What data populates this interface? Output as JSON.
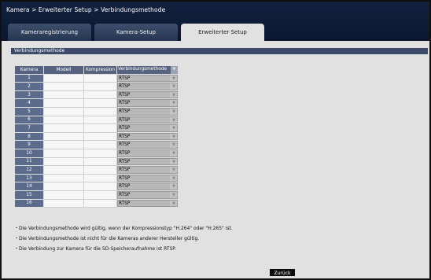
{
  "breadcrumb": "Kamera > Erweiterter Setup > Verbindungsmethode",
  "tabs": [
    {
      "label": "Kameraregistrierung",
      "active": false
    },
    {
      "label": "Kamera-Setup",
      "active": false
    },
    {
      "label": "Erweiterter Setup",
      "active": true
    }
  ],
  "section_title": "Verbindungsmethode",
  "table": {
    "headers": [
      "Kamera",
      "Modell",
      "Kompression",
      "Verbindungsmethode"
    ],
    "rows": [
      {
        "camera": "1",
        "model": "",
        "compression": "",
        "method": "RTSP"
      },
      {
        "camera": "2",
        "model": "",
        "compression": "",
        "method": "RTSP"
      },
      {
        "camera": "3",
        "model": "",
        "compression": "",
        "method": "RTSP"
      },
      {
        "camera": "4",
        "model": "",
        "compression": "",
        "method": "RTSP"
      },
      {
        "camera": "5",
        "model": "",
        "compression": "",
        "method": "RTSP"
      },
      {
        "camera": "6",
        "model": "",
        "compression": "",
        "method": "RTSP"
      },
      {
        "camera": "7",
        "model": "",
        "compression": "",
        "method": "RTSP"
      },
      {
        "camera": "8",
        "model": "",
        "compression": "",
        "method": "RTSP"
      },
      {
        "camera": "9",
        "model": "",
        "compression": "",
        "method": "RTSP"
      },
      {
        "camera": "10",
        "model": "",
        "compression": "",
        "method": "RTSP"
      },
      {
        "camera": "11",
        "model": "",
        "compression": "",
        "method": "RTSP"
      },
      {
        "camera": "12",
        "model": "",
        "compression": "",
        "method": "RTSP"
      },
      {
        "camera": "13",
        "model": "",
        "compression": "",
        "method": "RTSP"
      },
      {
        "camera": "14",
        "model": "",
        "compression": "",
        "method": "RTSP"
      },
      {
        "camera": "15",
        "model": "",
        "compression": "",
        "method": "RTSP"
      },
      {
        "camera": "16",
        "model": "",
        "compression": "",
        "method": "RTSP"
      }
    ]
  },
  "notes": [
    "Die Verbindungsmethode wird gültig, wenn der Kompressionstyp \"H.264\" oder \"H.265\" ist.",
    "Die Verbindungsmethode ist nicht für die Kameras anderer Hersteller gültig.",
    "Die Verbindung zur Kamera für die SD-Speicheraufnahme ist RTSP."
  ],
  "back_button": "Zurück",
  "icons": {
    "dropdown": "chevron-down-icon"
  },
  "colors": {
    "header_bar": "#12213f",
    "tab_inactive": "#2f405e",
    "section_bar": "#3b4a67",
    "background": "#e1e1e1",
    "camera_cell": "#5c6b8a",
    "select_bg": "#b8b8b8",
    "button_bg": "#0c0c0c"
  }
}
